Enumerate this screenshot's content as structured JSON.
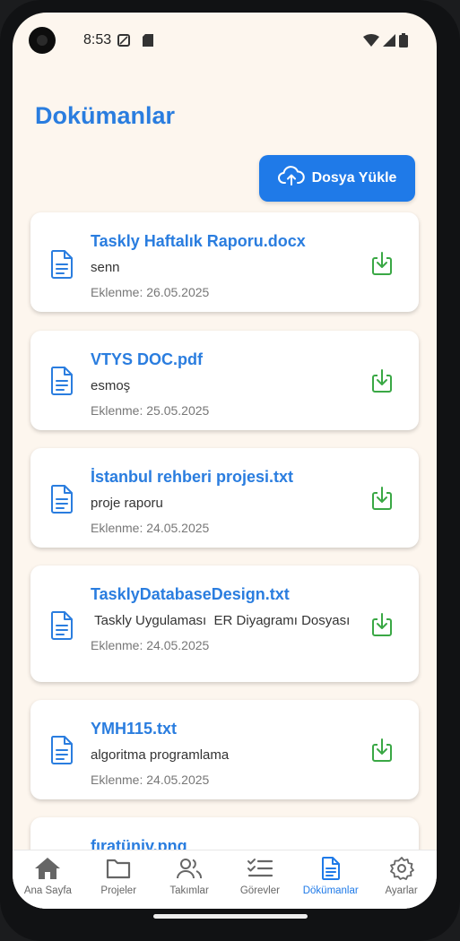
{
  "status_bar": {
    "time": "8:53"
  },
  "page": {
    "title": "Dokümanlar",
    "upload_label": "Dosya Yükle"
  },
  "documents": [
    {
      "name": "Taskly Haftalık Raporu.docx",
      "description": "senn",
      "date": "Eklenme: 26.05.2025"
    },
    {
      "name": "VTYS DOC.pdf",
      "description": "esmoş",
      "date": "Eklenme: 25.05.2025"
    },
    {
      "name": "İstanbul rehberi projesi.txt",
      "description": "proje raporu",
      "date": "Eklenme: 24.05.2025"
    },
    {
      "name": "TasklyDatabaseDesign.txt",
      "description": " Taskly Uygulaması  ER Diyagramı Dosyası",
      "date": "Eklenme: 24.05.2025"
    },
    {
      "name": "YMH115.txt",
      "description": "algoritma programlama",
      "date": "Eklenme: 24.05.2025"
    },
    {
      "name": "fıratüniv.png",
      "description": "",
      "date": ""
    }
  ],
  "nav": {
    "items": [
      {
        "label": "Ana Sayfa",
        "icon": "home-icon"
      },
      {
        "label": "Projeler",
        "icon": "folder-icon"
      },
      {
        "label": "Takımlar",
        "icon": "users-icon"
      },
      {
        "label": "Görevler",
        "icon": "checklist-icon"
      },
      {
        "label": "Dökümanlar",
        "icon": "document-icon"
      },
      {
        "label": "Ayarlar",
        "icon": "gear-icon"
      }
    ],
    "active_index": 4
  },
  "colors": {
    "accent": "#1f7ae8",
    "title": "#2a7ddf",
    "download": "#3aa845",
    "background": "#fdf6ee"
  }
}
